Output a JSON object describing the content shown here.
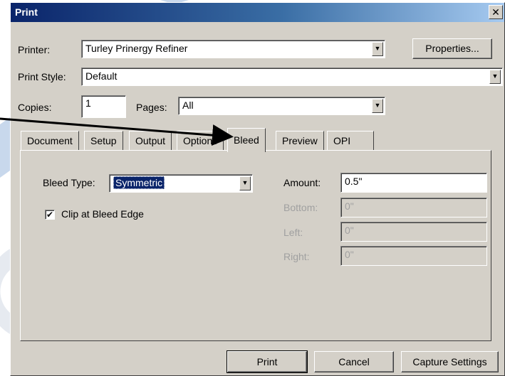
{
  "dialog": {
    "title": "Print",
    "close_glyph": "✕"
  },
  "printer": {
    "label": "Printer:",
    "value": "Turley Prinergy Refiner",
    "properties_button": "Properties..."
  },
  "print_style": {
    "label": "Print Style:",
    "value": "Default"
  },
  "copies": {
    "label": "Copies:",
    "value": "1"
  },
  "pages": {
    "label": "Pages:",
    "value": "All"
  },
  "tabs": [
    {
      "label": "Document"
    },
    {
      "label": "Setup"
    },
    {
      "label": "Output"
    },
    {
      "label": "Options"
    },
    {
      "label": "Bleed",
      "active": true
    },
    {
      "label": "Preview"
    },
    {
      "label": "OPI"
    }
  ],
  "bleed": {
    "type_label": "Bleed Type:",
    "type_value": "Symmetric",
    "clip_label": "Clip at Bleed Edge",
    "clip_checked": true,
    "amount_label": "Amount:",
    "amount_value": "0.5\"",
    "bottom_label": "Bottom:",
    "bottom_value": "0\"",
    "left_label": "Left:",
    "left_value": "0\"",
    "right_label": "Right:",
    "right_value": "0\""
  },
  "footer": {
    "print_button": "Print",
    "cancel_button": "Cancel",
    "capture_button": "Capture Settings"
  },
  "colors": {
    "dialog_face": "#d4d0c8",
    "titlebar_start": "#0a246a",
    "watermark": "#c8d8ec",
    "arrow": "#000000"
  },
  "icons": {
    "dropdown": "chevron-down-icon",
    "check": "checkmark-icon",
    "close": "close-icon"
  }
}
